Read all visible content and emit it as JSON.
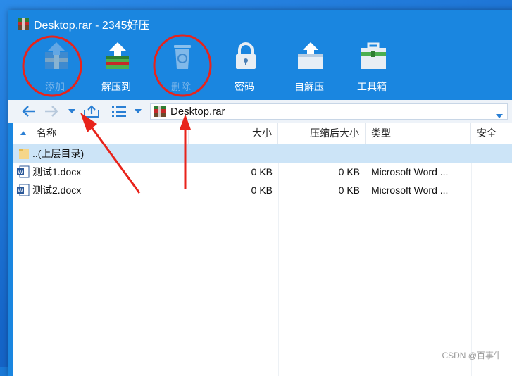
{
  "window": {
    "title": "Desktop.rar - 2345好压"
  },
  "toolbar": {
    "items": [
      {
        "label": "添加",
        "icon": "add-archive-icon",
        "enabled": false
      },
      {
        "label": "解压到",
        "icon": "extract-icon",
        "enabled": true
      },
      {
        "label": "删除",
        "icon": "recycle-bin-icon",
        "enabled": false
      },
      {
        "label": "密码",
        "icon": "lock-icon",
        "enabled": true
      },
      {
        "label": "自解压",
        "icon": "self-extract-icon",
        "enabled": true
      },
      {
        "label": "工具箱",
        "icon": "toolbox-icon",
        "enabled": true
      }
    ]
  },
  "address": {
    "path": "Desktop.rar",
    "icons": [
      "back-icon",
      "forward-icon",
      "dropdown-icon",
      "up-folder-icon",
      "view-list-icon",
      "archive-icon"
    ]
  },
  "file_list": {
    "columns": [
      {
        "label": "名称",
        "sort": "asc"
      },
      {
        "label": "大小"
      },
      {
        "label": "压缩后大小"
      },
      {
        "label": "类型"
      },
      {
        "label": "安全"
      }
    ],
    "rows": [
      {
        "name": "..(上层目录)",
        "size": "",
        "packed": "",
        "type": "",
        "icon": "folder-icon",
        "selected": true
      },
      {
        "name": "测试1.docx",
        "size": "0 KB",
        "packed": "0 KB",
        "type": "Microsoft Word ...",
        "icon": "word-doc-icon",
        "selected": false
      },
      {
        "name": "测试2.docx",
        "size": "0 KB",
        "packed": "0 KB",
        "type": "Microsoft Word ...",
        "icon": "word-doc-icon",
        "selected": false
      }
    ]
  },
  "watermark": "CSDN @百事牛",
  "colors": {
    "accent": "#1a86e0",
    "annotation": "#e8231b",
    "selection": "#cce4f7"
  }
}
